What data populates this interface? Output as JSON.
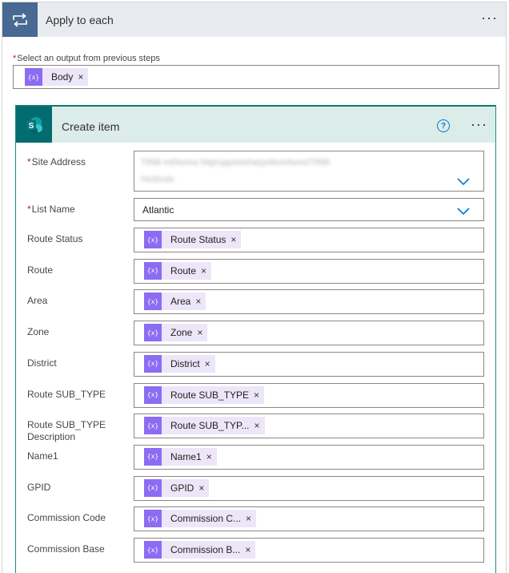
{
  "apply_to_each": {
    "title": "Apply to each",
    "more": "···",
    "select_label": "Select an output from previous steps",
    "required_mark": "*",
    "output_token": "Body",
    "token_close": "×"
  },
  "create_item": {
    "title": "Create item",
    "help": "?",
    "more": "···",
    "site_address_label": "Site Address",
    "site_address_line1": "TRlilt ml/lssma http/uppsissharpoitsm/tsms/TRlilt",
    "site_address_line2": "HoSiuds",
    "list_name_label": "List Name",
    "list_name_value": "Atlantic",
    "token_close": "×",
    "rows": [
      {
        "label": "Route Status",
        "token": "Route Status"
      },
      {
        "label": "Route",
        "token": "Route"
      },
      {
        "label": "Area",
        "token": "Area"
      },
      {
        "label": "Zone",
        "token": "Zone"
      },
      {
        "label": "District",
        "token": "District"
      },
      {
        "label": "Route SUB_TYPE",
        "token": "Route SUB_TYPE"
      },
      {
        "label": "Route SUB_TYPE Description",
        "token": "Route SUB_TYP..."
      },
      {
        "label": "Name1",
        "token": "Name1"
      },
      {
        "label": "GPID",
        "token": "GPID"
      },
      {
        "label": "Commission Code",
        "token": "Commission C..."
      },
      {
        "label": "Commission Base",
        "token": "Commission B..."
      }
    ]
  },
  "colors": {
    "apply_header_bg": "#e8ebf0",
    "apply_icon_bg": "#486991",
    "card_header_bg": "#dcece9",
    "card_border": "#0d7a70",
    "sharepoint_teal": "#036c70",
    "token_icon": "#8c6cf2",
    "token_bg": "#ece6f8",
    "required": "#a4262c",
    "accent_blue": "#0078d4"
  },
  "icons": {
    "apply_to_each": "loop-icon",
    "sharepoint": "sharepoint-icon",
    "dynamic_content": "dynamic-content-icon",
    "dropdown": "chevron-down-icon"
  }
}
